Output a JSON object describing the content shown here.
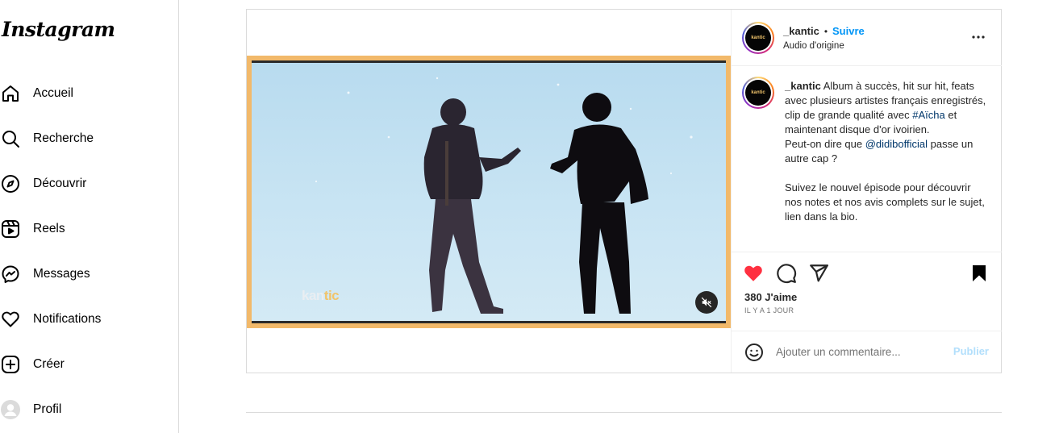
{
  "app": {
    "logo_text": "Instagram"
  },
  "sidebar": {
    "items": [
      {
        "label": "Accueil",
        "icon": "home-icon"
      },
      {
        "label": "Recherche",
        "icon": "search-icon"
      },
      {
        "label": "Découvrir",
        "icon": "compass-icon"
      },
      {
        "label": "Reels",
        "icon": "reels-icon"
      },
      {
        "label": "Messages",
        "icon": "messenger-icon"
      },
      {
        "label": "Notifications",
        "icon": "heart-icon"
      },
      {
        "label": "Créer",
        "icon": "plus-square-icon"
      },
      {
        "label": "Profil",
        "icon": "profile-avatar"
      }
    ]
  },
  "post": {
    "video": {
      "watermark_a": "kan",
      "watermark_b": "tic",
      "muted": true
    },
    "author": {
      "username": "_kantic",
      "separator": "•",
      "follow_label": "Suivre",
      "audio": "Audio d'origine",
      "avatar_text": "kantic"
    },
    "caption": {
      "username": "_kantic",
      "line1_pre": " Album à succès, hit sur hit, feats avec plusieurs artistes français enregistrés, clip de grande qualité avec ",
      "hashtag": "#Aïcha",
      "line1_post": " et maintenant disque d'or ivoirien.",
      "line2_pre": "Peut-on dire que ",
      "mention": "@didibofficial",
      "line2_post": " passe un autre cap ?",
      "line3": "Suivez le nouvel épisode pour découvrir nos notes et nos avis complets sur le sujet, lien dans la bio."
    },
    "likes": "380 J'aime",
    "time": "IL Y A 1 JOUR",
    "liked": true,
    "saved": true,
    "comment": {
      "placeholder": "Ajouter un commentaire...",
      "publish_label": "Publier"
    }
  },
  "colors": {
    "accent": "#0095f6",
    "like_red": "#ff3040",
    "video_frame": "#f2b96a"
  }
}
